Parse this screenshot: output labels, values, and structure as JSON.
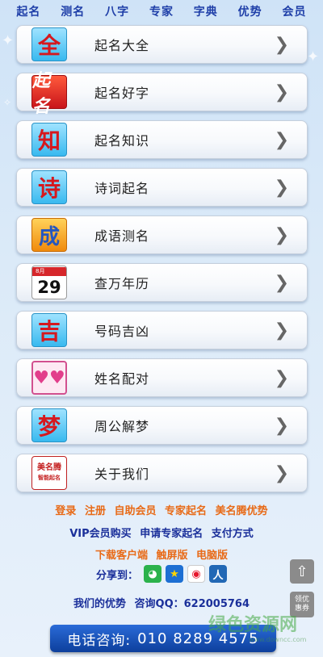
{
  "topnav": [
    "起名",
    "测名",
    "八字",
    "专家",
    "字典",
    "优势",
    "会员"
  ],
  "menu": [
    {
      "icon_text": "全",
      "icon": "quan-icon",
      "label": "起名大全"
    },
    {
      "icon_text": "起名",
      "icon": "qiming-calligraphy-icon",
      "label": "起名好字"
    },
    {
      "icon_text": "知",
      "icon": "zhi-icon",
      "label": "起名知识"
    },
    {
      "icon_text": "诗",
      "icon": "shi-icon",
      "label": "诗词起名"
    },
    {
      "icon_text": "成",
      "icon": "chengyu-icon",
      "label": "成语测名"
    },
    {
      "icon_text": "29",
      "icon_sub": "8月",
      "icon": "calendar-icon",
      "label": "查万年历"
    },
    {
      "icon_text": "吉",
      "icon": "ji-icon",
      "label": "号码吉凶"
    },
    {
      "icon_text": "♥♥",
      "icon": "hearts-icon",
      "label": "姓名配对"
    },
    {
      "icon_text": "梦",
      "icon": "meng-icon",
      "label": "周公解梦"
    },
    {
      "icon_text": "美名腾",
      "icon_sub": "智能起名",
      "icon": "meimingteng-seal-icon",
      "label": "关于我们"
    }
  ],
  "chevron": "❯",
  "footer": {
    "row1": [
      "登录",
      "注册",
      "自助会员",
      "专家起名",
      "美名腾优势"
    ],
    "row2": [
      "VIP会员购买",
      "申请专家起名",
      "支付方式"
    ],
    "row3": [
      "下载客户端",
      "触屏版",
      "电脑版"
    ],
    "share_label": "分享到：",
    "row5": [
      "我们的优势",
      "咨询QQ：622005764"
    ]
  },
  "side": {
    "to_top": "⇧",
    "coupon": "领优惠券"
  },
  "call": {
    "label": "电话咨询:",
    "number": "010 8289 4575"
  },
  "watermark": {
    "main": "绿色资源网",
    "sub": "www.downcc.com"
  },
  "colors": {
    "nav": "#1f3fa8",
    "footer_orange": "#e86a17",
    "footer_navy": "#1a2f9a",
    "callbar": "#1a52b8"
  }
}
